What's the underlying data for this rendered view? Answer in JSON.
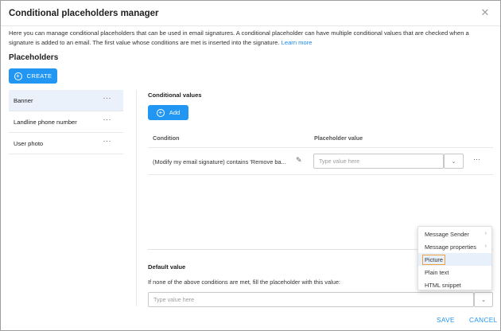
{
  "dialog": {
    "title": "Conditional placeholders manager",
    "close_glyph": "✕",
    "intro_text": "Here you can manage conditional placeholders that can be used in email signatures. A conditional placeholder can have multiple conditional values that are checked when a signature is added to an email. The first value whose conditions are met is inserted into the signature. ",
    "learn_more": "Learn more"
  },
  "placeholders": {
    "title": "Placeholders",
    "create_label": "CREATE",
    "items": [
      {
        "label": "Banner"
      },
      {
        "label": "Landline phone number"
      },
      {
        "label": "User photo"
      }
    ]
  },
  "conditional_values": {
    "title": "Conditional values",
    "add_label": "Add",
    "col_condition": "Condition",
    "col_value": "Placeholder value",
    "rows": [
      {
        "condition": "(Modify my email signature) contains 'Remove ba...",
        "value_placeholder": "Type value here"
      }
    ]
  },
  "default_value": {
    "title": "Default value",
    "description": "If none of the above conditions are met, fill the placeholder with this value:",
    "placeholder": "Type value here"
  },
  "menu": {
    "items": [
      {
        "label": "Message Sender",
        "submenu": true
      },
      {
        "label": "Message properties",
        "submenu": true
      },
      {
        "label": "Picture",
        "submenu": false,
        "highlighted": true
      },
      {
        "label": "Plain text",
        "submenu": false
      },
      {
        "label": "HTML snippet",
        "submenu": false
      }
    ]
  },
  "footer": {
    "save_label": "SAVE",
    "cancel_label": "CANCEL"
  },
  "icons": {
    "more": "···",
    "chevron_down": "⌄",
    "chevron_right": "›",
    "plus": "+",
    "pencil": "✎"
  },
  "colors": {
    "accent": "#2196f3",
    "highlight_border": "#f0a040",
    "active_row": "#eaf1fb"
  }
}
